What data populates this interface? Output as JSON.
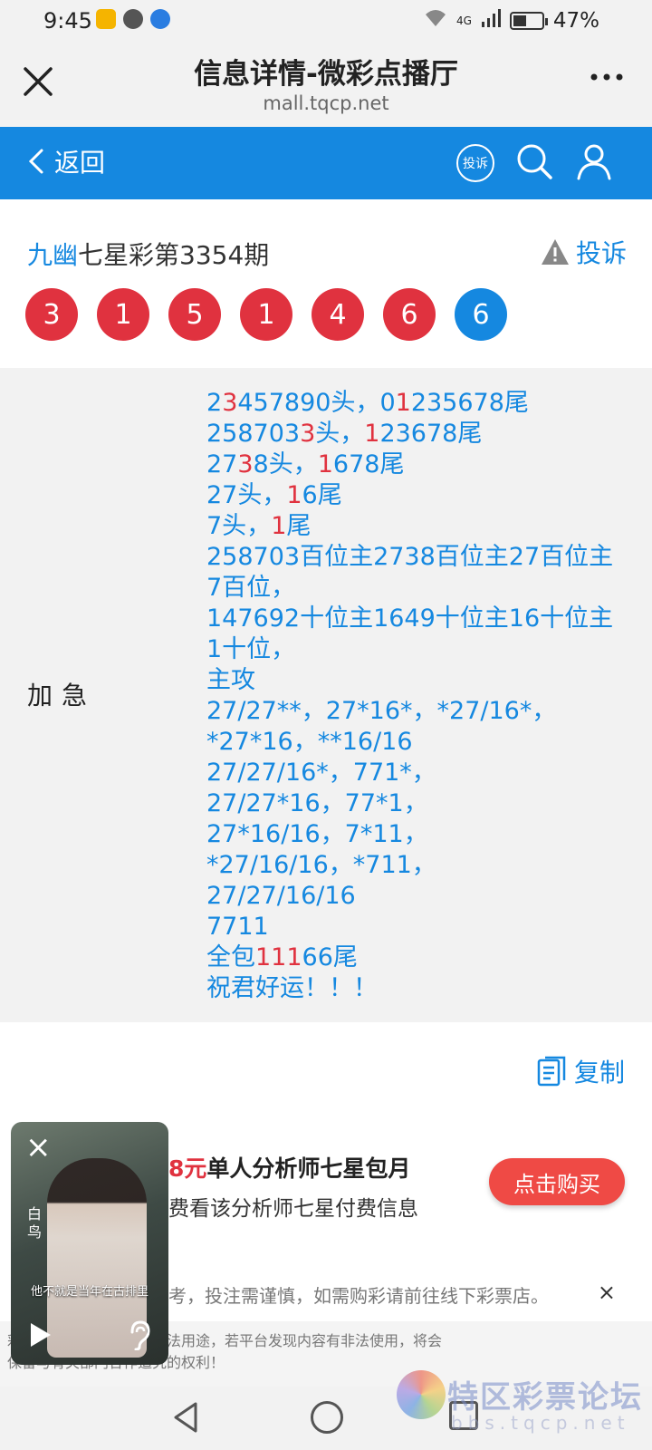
{
  "status_bar": {
    "time": "9:45",
    "network": "4G",
    "battery": "47%",
    "battery_level": 0.47
  },
  "title_bar": {
    "title": "信息详情-微彩点播厅",
    "url": "mall.tqcp.net",
    "close_icon": "close-icon",
    "more_icon": "more-icon"
  },
  "nav": {
    "back_label": "返回",
    "complain_badge": "投诉",
    "search_icon": "search-icon",
    "user_icon": "user-icon",
    "bg_color": "#1588e0"
  },
  "issue": {
    "prefix": "九幽",
    "title": "七星彩第3354期",
    "report_label": "投诉",
    "balls": [
      {
        "num": "3",
        "color": "#e0323f"
      },
      {
        "num": "1",
        "color": "#e0323f"
      },
      {
        "num": "5",
        "color": "#e0323f"
      },
      {
        "num": "1",
        "color": "#e0323f"
      },
      {
        "num": "4",
        "color": "#e0323f"
      },
      {
        "num": "6",
        "color": "#e0323f"
      },
      {
        "num": "6",
        "color": "#1588e0"
      }
    ]
  },
  "content": {
    "label": "加急",
    "lines": [
      [
        [
          "2",
          ""
        ],
        [
          "3",
          "r"
        ],
        [
          "457890头，0",
          ""
        ],
        [
          "1",
          "r"
        ],
        [
          "235678尾",
          ""
        ]
      ],
      [
        [
          "258703",
          ""
        ],
        [
          "3",
          "r"
        ],
        [
          "头，",
          ""
        ],
        [
          "1",
          "r"
        ],
        [
          "23678尾",
          ""
        ]
      ],
      [
        [
          "27",
          ""
        ],
        [
          "3",
          "r"
        ],
        [
          "8头，",
          ""
        ],
        [
          "1",
          "r"
        ],
        [
          "678尾",
          ""
        ]
      ],
      [
        [
          "27头，",
          ""
        ],
        [
          "1",
          "r"
        ],
        [
          "6尾",
          ""
        ]
      ],
      [
        [
          "7头，",
          ""
        ],
        [
          "1",
          "r"
        ],
        [
          "尾",
          ""
        ]
      ],
      [
        [
          "258703百位主2738百位主27百位主",
          ""
        ]
      ],
      [
        [
          "7百位，",
          ""
        ]
      ],
      [
        [
          "147692十位主1649十位主16十位主",
          ""
        ]
      ],
      [
        [
          "1十位，",
          ""
        ]
      ],
      [
        [
          "主攻",
          ""
        ]
      ],
      [
        [
          "27/27**，27*16*，*27/16*，",
          ""
        ]
      ],
      [
        [
          "*27*16，**16/16",
          ""
        ]
      ],
      [
        [
          "27/27/16*，771*，",
          ""
        ]
      ],
      [
        [
          "27/27*16，77*1，",
          ""
        ]
      ],
      [
        [
          "27*16/16，7*11，",
          ""
        ]
      ],
      [
        [
          "*27/16/16，*711，",
          ""
        ]
      ],
      [
        [
          "27/27/16/16",
          ""
        ]
      ],
      [
        [
          "7711",
          ""
        ]
      ],
      [
        [
          "全包",
          ""
        ],
        [
          "111",
          "r"
        ],
        [
          "66尾",
          ""
        ]
      ],
      [
        [
          "祝君好运！！！",
          ""
        ]
      ]
    ]
  },
  "copy": {
    "label": "复制"
  },
  "promo": {
    "price": "8元",
    "title": "单人分析师七星包月",
    "subtitle": "费看该分析师七星付费信息",
    "buy_label": "点击购买"
  },
  "notices": {
    "notice1": "考，投注需谨慎，如需购彩请前往线下彩票店。",
    "notice1_close": "×",
    "notice2": "彩！付费内容不得用于非法用途，若平台发现内容有非法使用，将会\n保留与有关部门合作追究的权利！"
  },
  "video": {
    "caption": "他不就是当年在古排里",
    "vertical_text": "白鸟",
    "close": "×"
  },
  "watermark": {
    "text": "特区彩票论坛",
    "sub": "bbs.tqcp.net"
  }
}
